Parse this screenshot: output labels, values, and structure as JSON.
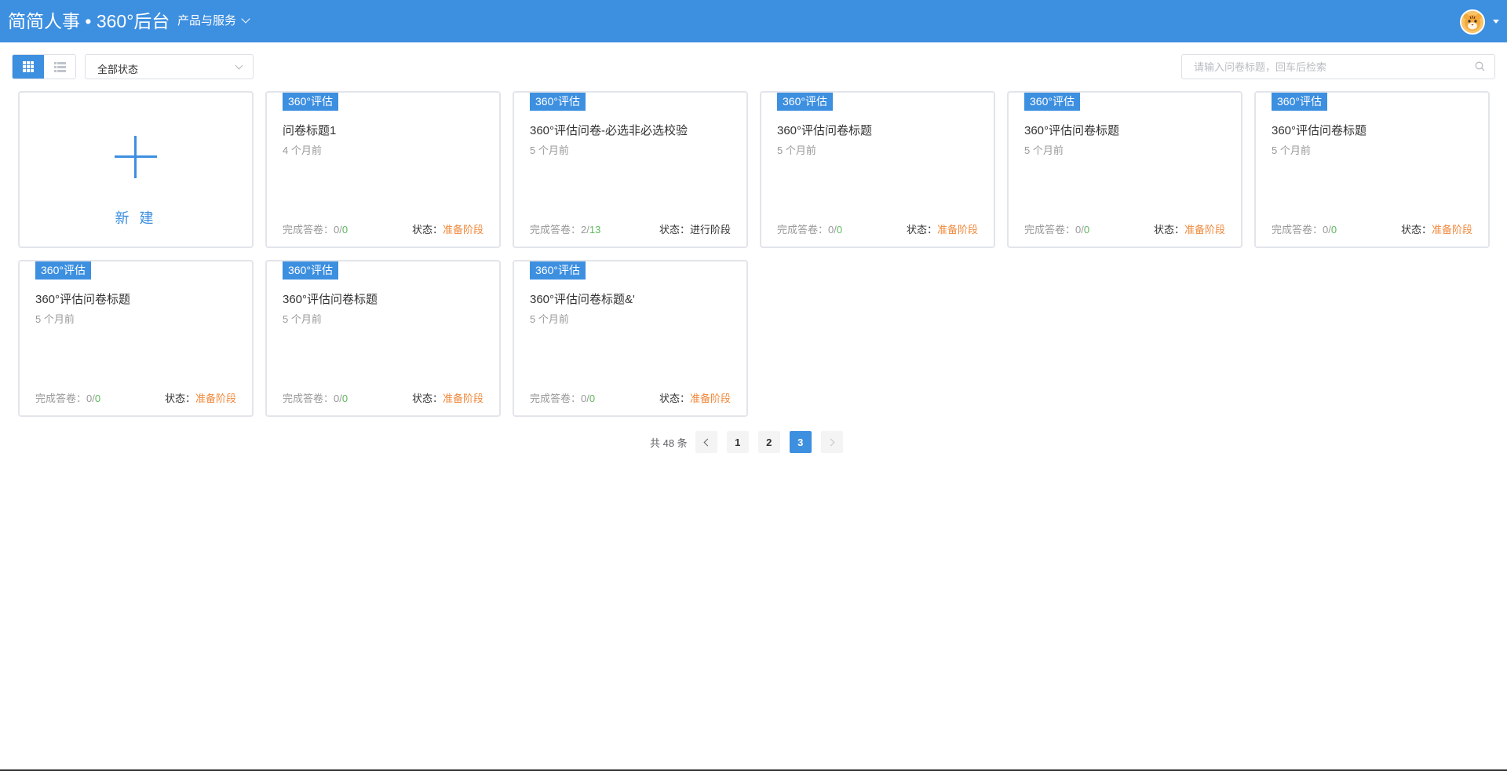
{
  "header": {
    "brand": "简简人事 • 360°后台",
    "nav_menu": "产品与服务"
  },
  "toolbar": {
    "status_select": "全部状态",
    "search_placeholder": "请输入问卷标题，回车后检索"
  },
  "new_card": {
    "label": "新 建"
  },
  "cards": [
    {
      "tag": "360°评估",
      "title": "问卷标题1",
      "time": "4 个月前",
      "done_label": "完成答卷：",
      "done_count": "0",
      "done_total": "0",
      "status_label": "状态：",
      "status": "准备阶段"
    },
    {
      "tag": "360°评估",
      "title": "360°评估问卷-必选非必选校验",
      "time": "5 个月前",
      "done_label": "完成答卷：",
      "done_count": "2",
      "done_total": "13",
      "status_label": "状态：",
      "status": "进行阶段"
    },
    {
      "tag": "360°评估",
      "title": "360°评估问卷标题",
      "time": "5 个月前",
      "done_label": "完成答卷：",
      "done_count": "0",
      "done_total": "0",
      "status_label": "状态：",
      "status": "准备阶段"
    },
    {
      "tag": "360°评估",
      "title": "360°评估问卷标题",
      "time": "5 个月前",
      "done_label": "完成答卷：",
      "done_count": "0",
      "done_total": "0",
      "status_label": "状态：",
      "status": "准备阶段"
    },
    {
      "tag": "360°评估",
      "title": "360°评估问卷标题",
      "time": "5 个月前",
      "done_label": "完成答卷：",
      "done_count": "0",
      "done_total": "0",
      "status_label": "状态：",
      "status": "准备阶段"
    },
    {
      "tag": "360°评估",
      "title": "360°评估问卷标题",
      "time": "5 个月前",
      "done_label": "完成答卷：",
      "done_count": "0",
      "done_total": "0",
      "status_label": "状态：",
      "status": "准备阶段"
    },
    {
      "tag": "360°评估",
      "title": "360°评估问卷标题",
      "time": "5 个月前",
      "done_label": "完成答卷：",
      "done_count": "0",
      "done_total": "0",
      "status_label": "状态：",
      "status": "准备阶段"
    },
    {
      "tag": "360°评估",
      "title": "360°评估问卷标题&'",
      "time": "5 个月前",
      "done_label": "完成答卷：",
      "done_count": "0",
      "done_total": "0",
      "status_label": "状态：",
      "status": "准备阶段"
    }
  ],
  "pagination": {
    "total": "共 48 条",
    "pages": [
      "1",
      "2",
      "3"
    ],
    "current": "3"
  },
  "colors": {
    "primary": "#3d8fe0",
    "prep_stage": "#f0883a",
    "count_green": "#5cb85c"
  }
}
